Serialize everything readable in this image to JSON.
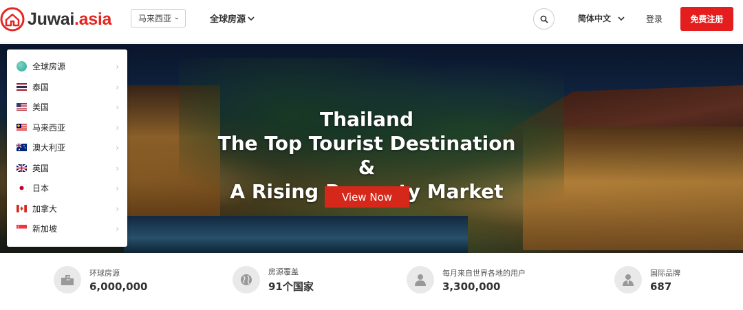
{
  "header": {
    "logo_text_main": "Juwai",
    "logo_text_suffix": ".asia",
    "region": "马来西亚",
    "nav_global": "全球房源",
    "language": "简体中文",
    "login": "登录",
    "register": "免费注册"
  },
  "hero": {
    "title_line1": "Thailand",
    "title_line2": "The Top Tourist Destination &",
    "title_line3": "A Rising Property Market",
    "cta": "View Now"
  },
  "menu": {
    "items": [
      {
        "label": "全球房源",
        "icon": "globe-icon"
      },
      {
        "label": "泰国",
        "icon": "flag-thailand-icon"
      },
      {
        "label": "美国",
        "icon": "flag-usa-icon"
      },
      {
        "label": "马来西亚",
        "icon": "flag-malaysia-icon"
      },
      {
        "label": "澳大利亚",
        "icon": "flag-australia-icon"
      },
      {
        "label": "英国",
        "icon": "flag-uk-icon"
      },
      {
        "label": "日本",
        "icon": "flag-japan-icon"
      },
      {
        "label": "加拿大",
        "icon": "flag-canada-icon"
      },
      {
        "label": "新加坡",
        "icon": "flag-singapore-icon"
      }
    ]
  },
  "stats": [
    {
      "label": "环球房源",
      "value": "6,000,000",
      "icon": "building-icon"
    },
    {
      "label": "房源覆盖",
      "value": "91个国家",
      "icon": "globe-icon"
    },
    {
      "label": "每月来自世界各地的用户",
      "value": "3,300,000",
      "icon": "user-icon"
    },
    {
      "label": "国际品牌",
      "value": "687",
      "icon": "agent-icon"
    }
  ],
  "colors": {
    "brand_red": "#e52521",
    "cta_red": "#d5281b",
    "register_red": "#e41e1e"
  }
}
